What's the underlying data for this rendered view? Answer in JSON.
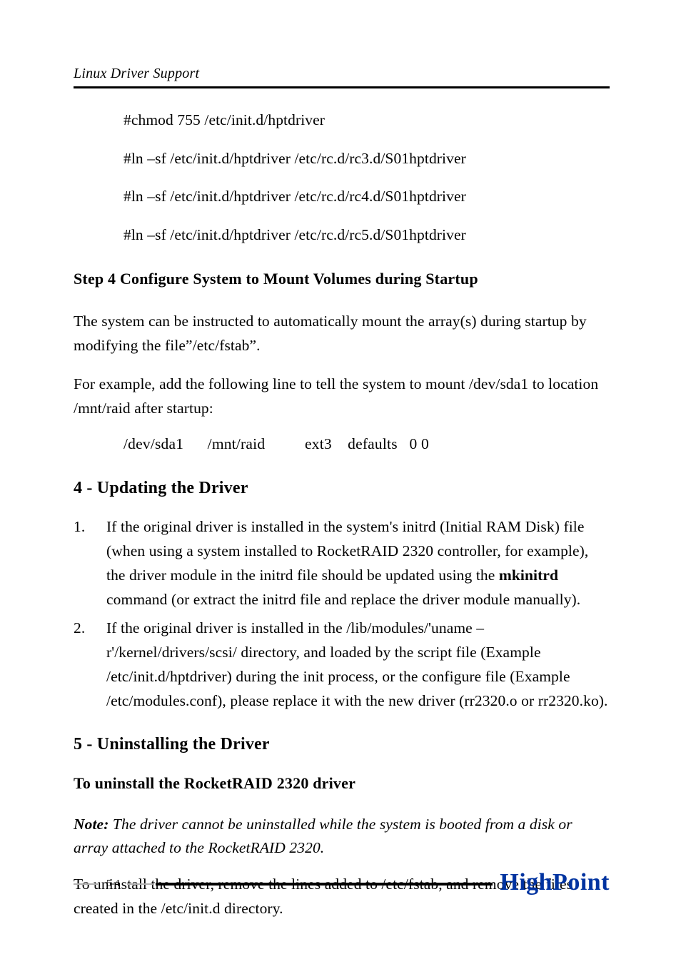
{
  "header": {
    "running": "Linux Driver Support"
  },
  "commands": [
    "#chmod 755 /etc/init.d/hptdriver",
    "#ln –sf /etc/init.d/hptdriver /etc/rc.d/rc3.d/S01hptdriver",
    "#ln –sf /etc/init.d/hptdriver /etc/rc.d/rc4.d/S01hptdriver",
    "#ln –sf /etc/init.d/hptdriver /etc/rc.d/rc5.d/S01hptdriver"
  ],
  "step4": {
    "title": "Step 4 Configure System to Mount Volumes during Startup",
    "p1": "The system can be instructed to automatically mount the array(s) during startup by modifying the file”/etc/fstab”.",
    "p2": "For example, add the following line to tell the system to mount /dev/sda1 to location /mnt/raid after startup:",
    "fstab": "/dev/sda1      /mnt/raid          ext3    defaults   0 0"
  },
  "sec4": {
    "title": "4 - Updating the Driver",
    "items": [
      {
        "num": "1.",
        "pre": "If the original driver is installed in the system's initrd (Initial RAM Disk) file (when using a system installed to RocketRAID 2320 controller, for example), the driver module in the initrd file should be updated using the ",
        "bold": "mkinitrd",
        "post": " command (or extract the initrd file and replace the driver module manually)."
      },
      {
        "num": "2.",
        "pre": "If the original driver is installed in the /lib/modules/'uname –r'/kernel/drivers/scsi/ directory, and loaded by the script file (Example /etc/init.d/hptdriver) during the init process, or the configure file (Example /etc/modules.conf), please replace it with the new driver (rr2320.o or rr2320.ko).",
        "bold": "",
        "post": ""
      }
    ]
  },
  "sec5": {
    "title": "5 - Uninstalling the Driver",
    "sub": "To uninstall the RocketRAID 2320 driver",
    "note_label": "Note:",
    "note_body": " The driver cannot be uninstalled while the system is booted from a disk or array attached to the RocketRAID 2320.",
    "p": "To uninstall the driver, remove the lines added to /etc/fstab, and remove the files created in the /etc/init.d directory."
  },
  "footer": {
    "page": "5-4",
    "brand": "HighPoint"
  }
}
